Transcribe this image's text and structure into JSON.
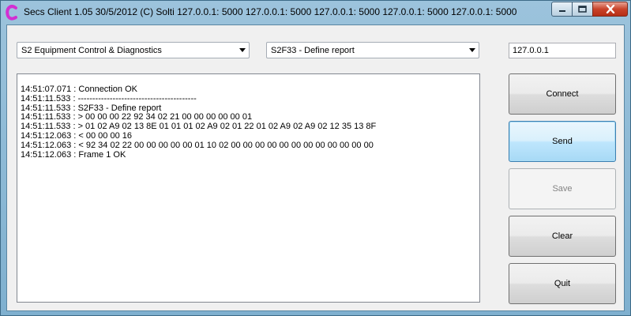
{
  "window": {
    "title": "Secs Client 1.05 30/5/2012 (C) Solti    127.0.0.1: 5000   127.0.0.1: 5000   127.0.0.1: 5000   127.0.0.1: 5000   127.0.0.1: 5000"
  },
  "stream_select": {
    "value": "S2 Equipment Control & Diagnostics"
  },
  "message_select": {
    "value": "S2F33 - Define report"
  },
  "ip_address": {
    "value": "127.0.0.1"
  },
  "log": {
    "lines": [
      "14:51:07.071 : Connection OK",
      "14:51:11.533 : -----------------------------------------",
      "14:51:11.533 : S2F33 - Define report",
      "14:51:11.533 : > 00 00 00 22 92 34 02 21 00 00 00 00 00 01",
      "14:51:11.533 : > 01 02 A9 02 13 8E 01 01 01 02 A9 02 01 22 01 02 A9 02 A9 02 12 35 13 8F",
      "14:51:12.063 : < 00 00 00 16",
      "14:51:12.063 : < 92 34 02 22 00 00 00 00 00 01 10 02 00 00 00 00 00 00 00 00 00 00 00 00",
      "14:51:12.063 : Frame 1 OK"
    ]
  },
  "buttons": {
    "connect": "Connect",
    "send": "Send",
    "save": "Save",
    "clear": "Clear",
    "quit": "Quit"
  },
  "icons": {
    "app": "app-c-logo-icon",
    "minimize": "minimize-icon",
    "maximize": "maximize-icon",
    "close": "close-icon",
    "dropdown": "chevron-down-icon"
  },
  "colors": {
    "app_logo": "#d22fd2",
    "close_button": "#c9432a",
    "focus_border": "#3c7fb1"
  }
}
